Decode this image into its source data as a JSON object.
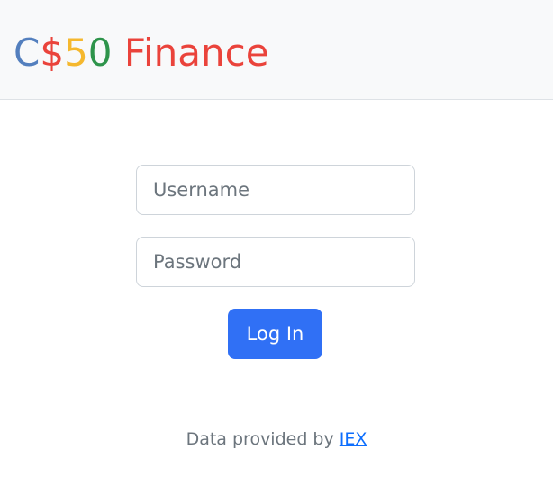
{
  "brand": {
    "parts": [
      {
        "text": "C",
        "color": "#537fbe"
      },
      {
        "text": "$",
        "color": "#ea433b"
      },
      {
        "text": "5",
        "color": "#f5b82e"
      },
      {
        "text": "0",
        "color": "#2e944b"
      },
      {
        "text": " Finance",
        "color": "#ea433b"
      }
    ]
  },
  "form": {
    "username_placeholder": "Username",
    "username_value": "",
    "password_placeholder": "Password",
    "password_value": "",
    "login_label": "Log In",
    "login_color": "#3070f5"
  },
  "footer": {
    "prefix": "Data provided by ",
    "link_text": "IEX"
  }
}
